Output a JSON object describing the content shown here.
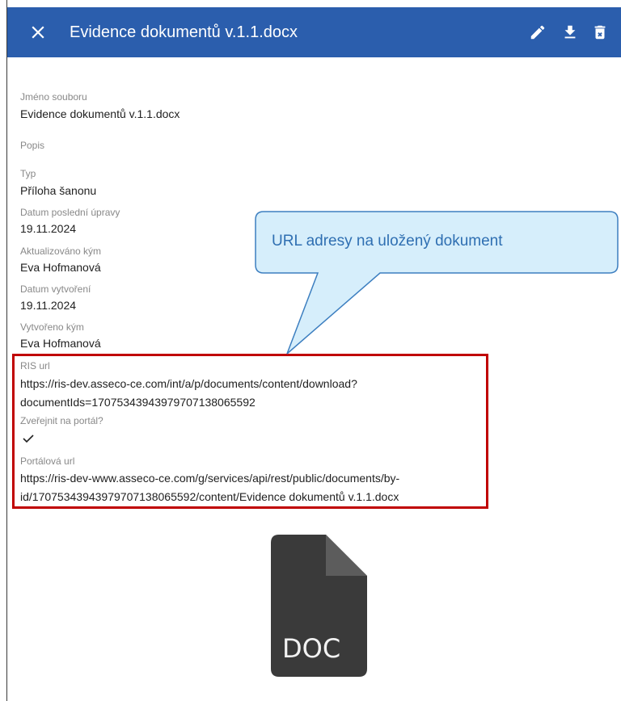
{
  "header": {
    "title": "Evidence dokumentů v.1.1.docx",
    "close_icon": "close-icon",
    "actions": [
      "edit-icon",
      "download-icon",
      "delete-icon"
    ]
  },
  "fields": {
    "file_name": {
      "label": "Jméno souboru",
      "value": "Evidence dokumentů v.1.1.docx"
    },
    "description": {
      "label": "Popis"
    },
    "type": {
      "label": "Typ",
      "value": "Příloha šanonu"
    },
    "modified_date": {
      "label": "Datum poslední úpravy",
      "value": "19.11.2024"
    },
    "modified_by": {
      "label": "Aktualizováno kým",
      "value": "Eva Hofmanová"
    },
    "created_date": {
      "label": "Datum vytvoření",
      "value": "19.11.2024"
    },
    "created_by": {
      "label": "Vytvořeno kým",
      "value": "Eva Hofmanová"
    },
    "ris_url": {
      "label": "RIS url",
      "line1": "https://ris-dev.asseco-ce.com/int/a/p/documents/content/download?",
      "line2": "documentIds=170753439439797071380655​92"
    },
    "publish": {
      "label": "Zveřejnit na portál?",
      "checked": true
    },
    "portal_url": {
      "label": "Portálová url",
      "line1": "https://ris-dev-www.asseco-ce.com/g/services/api/rest/public/documents/by-",
      "line2": "id/170753439439797071380655​92/content/Evidence dokumentů v.1.1.docx"
    }
  },
  "callout": {
    "text": "URL adresy na uložený dokument"
  },
  "preview": {
    "label": "DOC"
  },
  "colors": {
    "header_bg": "#2b5ead",
    "highlight_border": "#c00000",
    "callout_fill": "#d6eefb",
    "callout_stroke": "#3d7fc0",
    "callout_text": "#2f6fb2",
    "doc_icon": "#3a3a3a"
  }
}
